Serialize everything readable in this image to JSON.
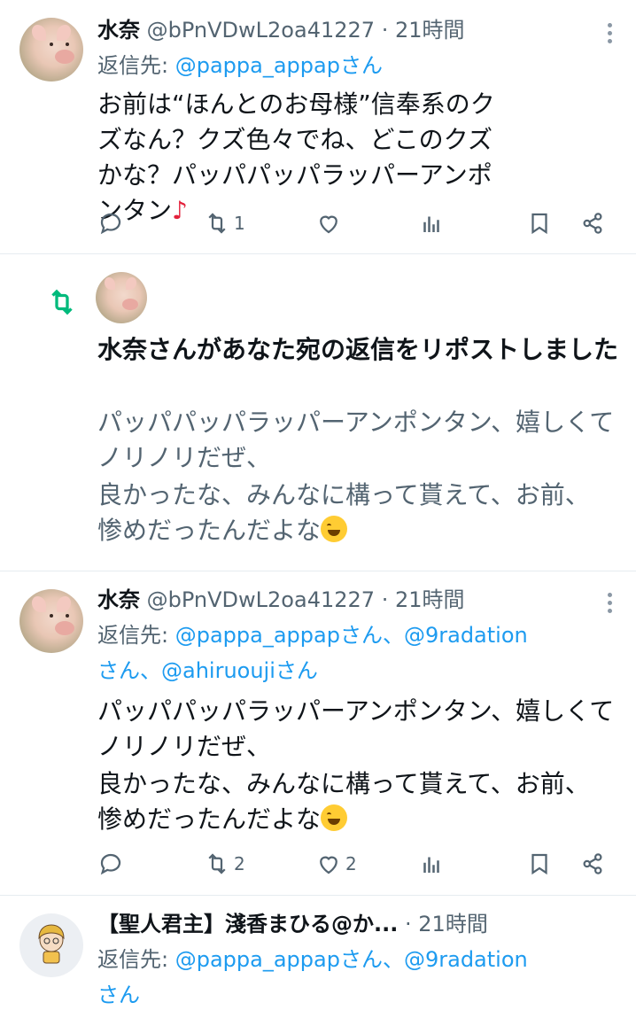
{
  "tweets": [
    {
      "name": "水奈",
      "handle": "@bPnVDwL2oa41227",
      "sep": "·",
      "time": "21時間",
      "reply_prefix": "返信先:",
      "reply_mentions": "@pappa_appapさん",
      "text": "お前は“ほんとのお母様”信奉系のクズなん？クズ色々でね、どこのクズかな？パッパパッパラッパーアンポンタン",
      "text_suffix": "♪",
      "replies": "",
      "retweets": "1",
      "likes": ""
    },
    {
      "notice": "水奈さんがあなた宛の返信をリポストしました",
      "quoted_line1": "パッパパッパラッパーアンポンタン、嬉しくてノリノリだぜ、",
      "quoted_line2": "良かったな、みんなに構って貰えて、お前、惨めだったんだよな"
    },
    {
      "name": "水奈",
      "handle": "@bPnVDwL2oa41227",
      "sep": "·",
      "time": "21時間",
      "reply_prefix": "返信先:",
      "reply_mention1": "@pappa_appapさん、",
      "reply_mention2": "@9radation",
      "reply_mention3": "さん、@ahiruoujiさん",
      "line1": "パッパパッパラッパーアンポンタン、嬉しくてノリノリだぜ、",
      "line2": "良かったな、みんなに構って貰えて、お前、惨めだったんだよな",
      "retweets": "2",
      "likes": "2"
    },
    {
      "name": "【聖人君主】淺香まひる@か...",
      "sep": "·",
      "time": "21時間",
      "reply_prefix": "返信先:",
      "reply_mention1": "@pappa_appapさん、",
      "reply_mention2": "@9radation",
      "reply_mention3": "さん"
    }
  ],
  "colors": {
    "text": "#0f1419",
    "muted": "#536471",
    "link": "#1d9bf0",
    "retweet_green": "#00ba7c",
    "divider": "#e6ecf0"
  },
  "icons": [
    "reply-icon",
    "retweet-icon",
    "like-icon",
    "views-icon",
    "bookmark-icon",
    "share-icon",
    "more-icon"
  ]
}
